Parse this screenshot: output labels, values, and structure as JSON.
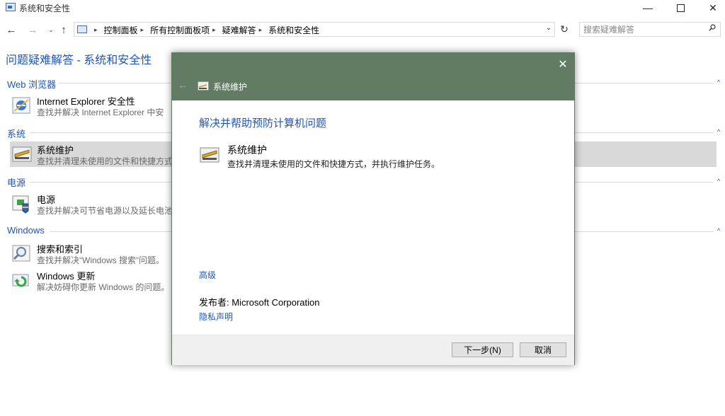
{
  "window": {
    "title": "系统和安全性",
    "controls": {
      "minimize": "—",
      "maximize": "□",
      "close": "✕"
    }
  },
  "nav": {
    "back_icon": "←",
    "forward_icon": "→",
    "recent_icon": "⌄",
    "up_icon": "↑",
    "breadcrumbs": [
      "控制面板",
      "所有控制面板项",
      "疑难解答",
      "系统和安全性"
    ],
    "dropdown_icon": "⌄",
    "refresh_icon": "↻",
    "search_placeholder": "搜索疑难解答"
  },
  "page": {
    "title": "问题疑难解答 - 系统和安全性",
    "categories": [
      {
        "title": "Web 浏览器",
        "items": [
          {
            "title": "Internet Explorer 安全性",
            "desc": "查找并解决 Internet Explorer 中安",
            "icon": "ie-security-icon"
          }
        ]
      },
      {
        "title": "系统",
        "items": [
          {
            "title": "系统维护",
            "desc": "查找并清理未使用的文件和快捷方式",
            "icon": "system-maintenance-icon",
            "selected": true
          }
        ]
      },
      {
        "title": "电源",
        "items": [
          {
            "title": "电源",
            "desc": "查找并解决可节省电源以及延长电池",
            "icon": "power-icon"
          }
        ]
      },
      {
        "title": "Windows",
        "items": [
          {
            "title": "搜索和索引",
            "desc": "查找并解决“Windows 搜索”问题。",
            "icon": "search-indexing-icon"
          },
          {
            "title": "Windows 更新",
            "desc": "解决妨碍你更新 Windows 的问题。",
            "icon": "windows-update-icon"
          }
        ]
      }
    ],
    "collapse_icon": "^"
  },
  "dialog": {
    "close_icon": "✕",
    "back_icon": "←",
    "header_title": "系统维护",
    "heading": "解决并帮助预防计算机问题",
    "item_title": "系统维护",
    "item_desc": "查找并清理未使用的文件和快捷方式，并执行维护任务。",
    "advanced_link": "高级",
    "publisher": "发布者:  Microsoft Corporation",
    "privacy_link": "隐私声明",
    "next_button": "下一步(N)",
    "cancel_button": "取消"
  },
  "colors": {
    "accent": "#1e56b8",
    "dialog_header": "#627c64",
    "selected_row": "#d9d9d9"
  }
}
